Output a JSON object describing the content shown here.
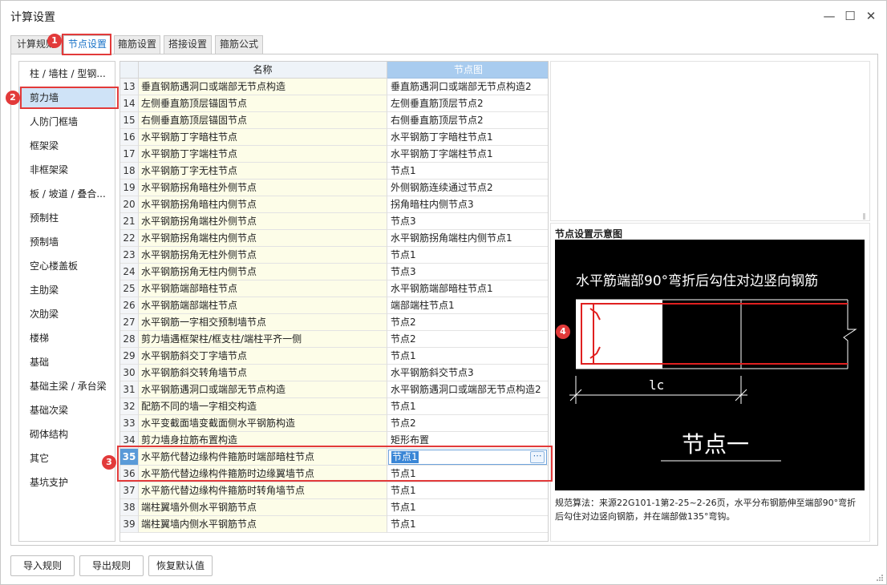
{
  "window": {
    "title": "计算设置",
    "controls": {
      "minimize": "—",
      "maximize": "☐",
      "close": "✕"
    }
  },
  "tabs": [
    {
      "label": "计算规则"
    },
    {
      "label": "节点设置",
      "active": true
    },
    {
      "label": "箍筋设置"
    },
    {
      "label": "搭接设置"
    },
    {
      "label": "箍筋公式"
    }
  ],
  "sidebar": {
    "items": [
      {
        "label": "柱 / 墙柱 / 型钢..."
      },
      {
        "label": "剪力墙",
        "selected": true
      },
      {
        "label": "人防门框墙"
      },
      {
        "label": "框架梁"
      },
      {
        "label": "非框架梁"
      },
      {
        "label": "板 / 坡道 / 叠合..."
      },
      {
        "label": "预制柱"
      },
      {
        "label": "预制墙"
      },
      {
        "label": "空心楼盖板"
      },
      {
        "label": "主肋梁"
      },
      {
        "label": "次肋梁"
      },
      {
        "label": "楼梯"
      },
      {
        "label": "基础"
      },
      {
        "label": "基础主梁 / 承台梁"
      },
      {
        "label": "基础次梁"
      },
      {
        "label": "砌体结构"
      },
      {
        "label": "其它"
      },
      {
        "label": "基坑支护"
      }
    ]
  },
  "grid": {
    "columns": {
      "name": "名称",
      "node": "节点图"
    },
    "selected_row": "35",
    "rows": [
      {
        "num": "13",
        "name": "垂直钢筋遇洞口或端部无节点构造",
        "node": "垂直筋遇洞口或端部无节点构造2"
      },
      {
        "num": "14",
        "name": "左侧垂直筋顶层锚固节点",
        "node": "左侧垂直筋顶层节点2"
      },
      {
        "num": "15",
        "name": "右侧垂直筋顶层锚固节点",
        "node": "右侧垂直筋顶层节点2"
      },
      {
        "num": "16",
        "name": "水平钢筋丁字暗柱节点",
        "node": "水平钢筋丁字暗柱节点1"
      },
      {
        "num": "17",
        "name": "水平钢筋丁字端柱节点",
        "node": "水平钢筋丁字端柱节点1"
      },
      {
        "num": "18",
        "name": "水平钢筋丁字无柱节点",
        "node": "节点1"
      },
      {
        "num": "19",
        "name": "水平钢筋拐角暗柱外侧节点",
        "node": "外侧钢筋连续通过节点2"
      },
      {
        "num": "20",
        "name": "水平钢筋拐角暗柱内侧节点",
        "node": "拐角暗柱内侧节点3"
      },
      {
        "num": "21",
        "name": "水平钢筋拐角端柱外侧节点",
        "node": "节点3"
      },
      {
        "num": "22",
        "name": "水平钢筋拐角端柱内侧节点",
        "node": "水平钢筋拐角端柱内侧节点1"
      },
      {
        "num": "23",
        "name": "水平钢筋拐角无柱外侧节点",
        "node": "节点1"
      },
      {
        "num": "24",
        "name": "水平钢筋拐角无柱内侧节点",
        "node": "节点3"
      },
      {
        "num": "25",
        "name": "水平钢筋端部暗柱节点",
        "node": "水平钢筋端部暗柱节点1"
      },
      {
        "num": "26",
        "name": "水平钢筋端部端柱节点",
        "node": "端部端柱节点1"
      },
      {
        "num": "27",
        "name": "水平钢筋一字相交预制墙节点",
        "node": "节点2"
      },
      {
        "num": "28",
        "name": "剪力墙遇框架柱/框支柱/端柱平齐一侧",
        "node": "节点2"
      },
      {
        "num": "29",
        "name": "水平钢筋斜交丁字墙节点",
        "node": "节点1"
      },
      {
        "num": "30",
        "name": "水平钢筋斜交转角墙节点",
        "node": "水平钢筋斜交节点3"
      },
      {
        "num": "31",
        "name": "水平钢筋遇洞口或端部无节点构造",
        "node": "水平钢筋遇洞口或端部无节点构造2"
      },
      {
        "num": "32",
        "name": "配筋不同的墙一字相交构造",
        "node": "节点1"
      },
      {
        "num": "33",
        "name": "水平变截面墙变截面侧水平钢筋构造",
        "node": "节点2"
      },
      {
        "num": "34",
        "name": "剪力墙身拉筋布置构造",
        "node": "矩形布置"
      },
      {
        "num": "35",
        "name": "水平筋代替边缘构件箍筋时端部暗柱节点",
        "node": "节点1"
      },
      {
        "num": "36",
        "name": "水平筋代替边缘构件箍筋时边缘翼墙节点",
        "node": "节点1"
      },
      {
        "num": "37",
        "name": "水平筋代替边缘构件箍筋时转角墙节点",
        "node": "节点1"
      },
      {
        "num": "38",
        "name": "端柱翼墙外侧水平钢筋节点",
        "node": "节点1"
      },
      {
        "num": "39",
        "name": "端柱翼墙内侧水平钢筋节点",
        "node": "节点1"
      }
    ]
  },
  "diagram": {
    "title": "节点设置示意图",
    "caption": "水平筋端部90°弯折后勾住对边竖向钢筋",
    "dimension_label": "lc",
    "node_label": "节点一",
    "note": "规范算法：来源22G101-1第2-25~2-26页，水平分布钢筋伸至端部90°弯折后勾住对边竖向钢筋，并在端部做135°弯钩。",
    "colors": {
      "background": "#000000",
      "rebar": "#e02020",
      "line": "#ffffff"
    }
  },
  "buttons": {
    "import": "导入规则",
    "export": "导出规则",
    "restore": "恢复默认值"
  },
  "annotations": [
    {
      "label": "1"
    },
    {
      "label": "2"
    },
    {
      "label": "3"
    },
    {
      "label": "4"
    }
  ],
  "colors": {
    "accent": "#1a73c8",
    "annotation_red": "#e23a3a",
    "header_selected": "#a9ccef",
    "name_cell_bg": "#fdfde8"
  }
}
